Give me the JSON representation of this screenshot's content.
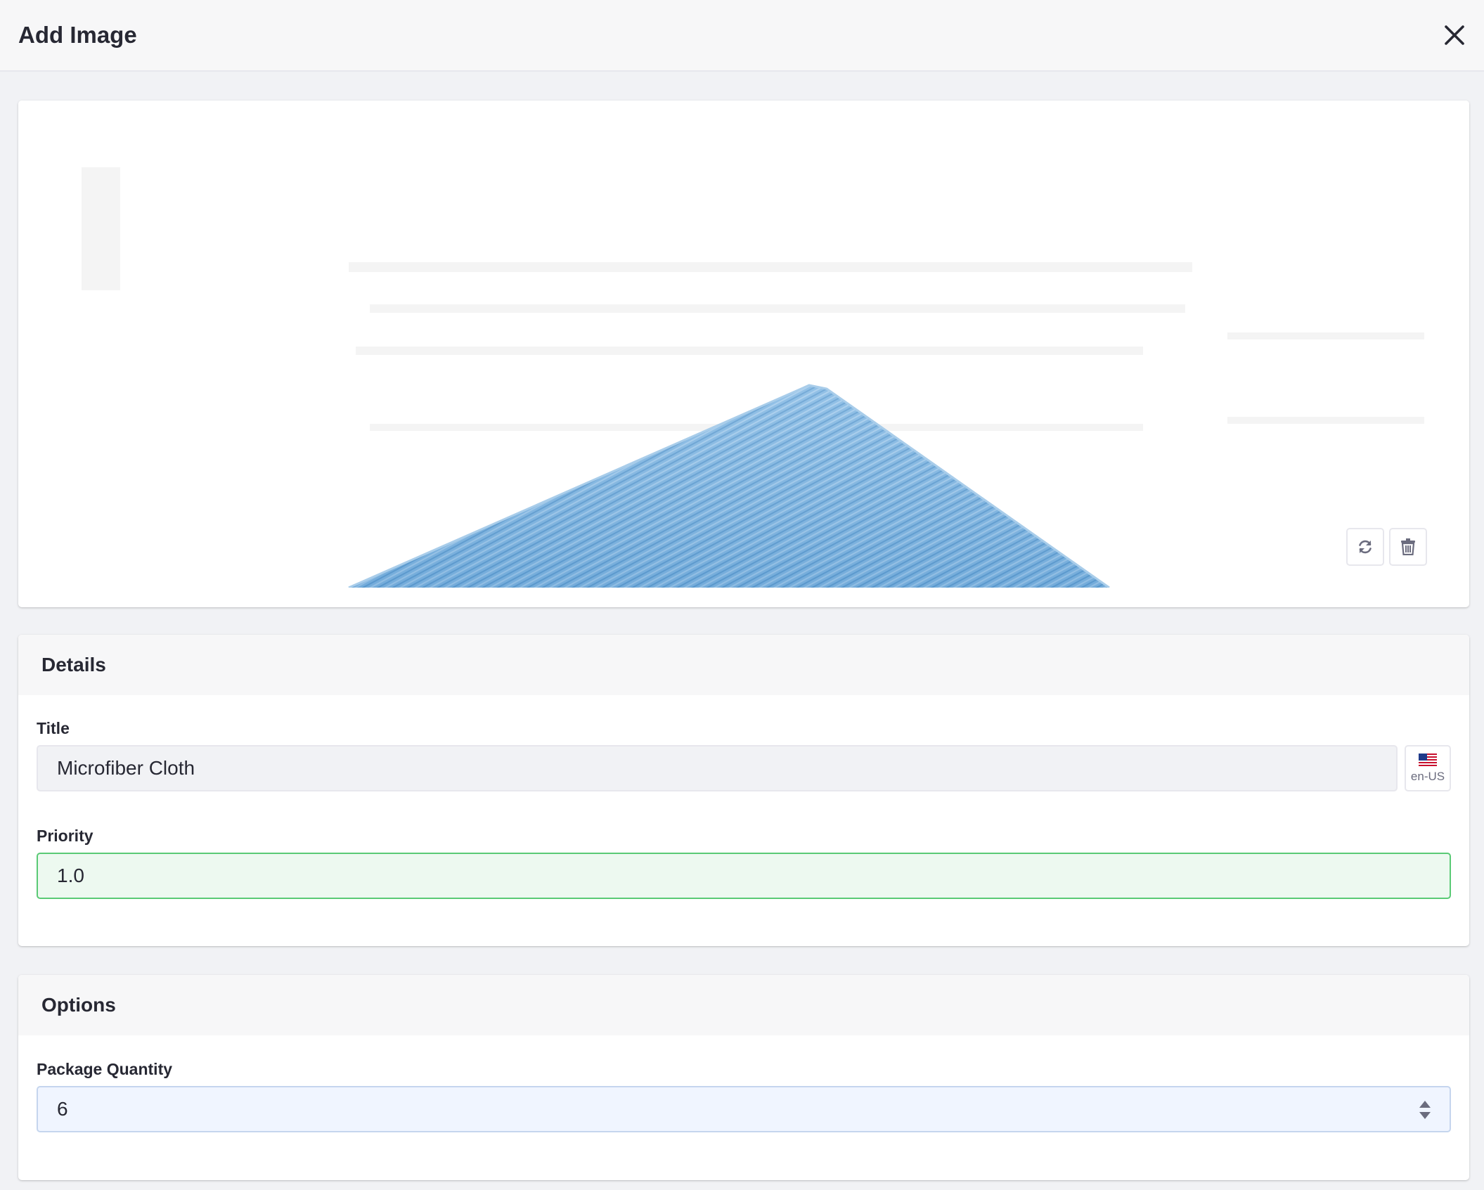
{
  "modal": {
    "title": "Add Image",
    "close_icon": "close-icon"
  },
  "image_card": {
    "actions": [
      {
        "name": "change-image-button",
        "icon": "refresh-icon"
      },
      {
        "name": "delete-image-button",
        "icon": "trash-icon"
      }
    ]
  },
  "details": {
    "header": "Details",
    "title_label": "Title",
    "title_value": "Microfiber Cloth",
    "language": "en-US",
    "language_icon": "us-flag-icon",
    "priority_label": "Priority",
    "priority_value": "1.0"
  },
  "options": {
    "header": "Options",
    "package_quantity_label": "Package Quantity",
    "package_quantity_value": "6",
    "stepper_icon": "caret-double-icon"
  },
  "colors": {
    "valid_border": "#5aca75",
    "valid_background": "#edf9f0",
    "cloth_blue": "#7fb5e0"
  }
}
